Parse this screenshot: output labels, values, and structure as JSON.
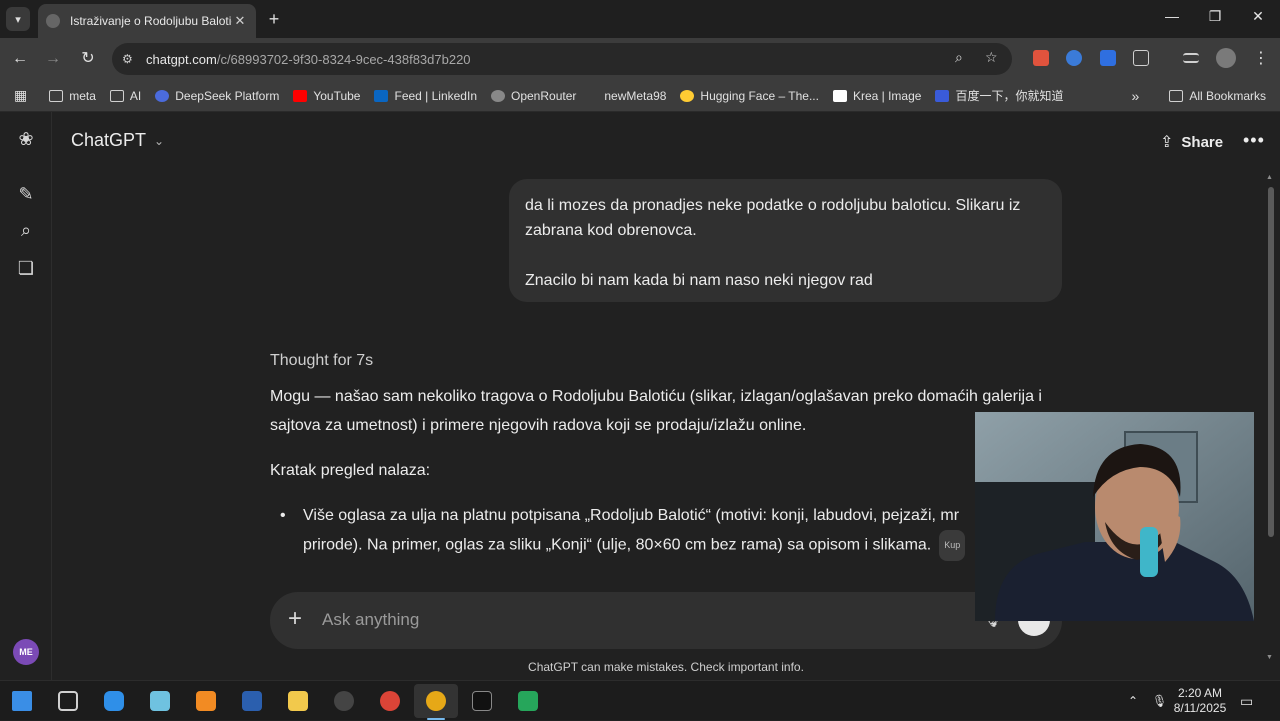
{
  "browser": {
    "tab": {
      "title": "Istraživanje o Rodoljubu Balotić"
    },
    "address": {
      "domain": "chatgpt.com",
      "path": "/c/68993702-9f30-8324-9cec-438f83d7b220"
    },
    "bookmarks": [
      {
        "label": "meta",
        "icon": "folder-icon"
      },
      {
        "label": "AI",
        "icon": "folder-icon"
      },
      {
        "label": "DeepSeek Platform",
        "icon": "deepseek-icon"
      },
      {
        "label": "YouTube",
        "icon": "youtube-icon"
      },
      {
        "label": "Feed | LinkedIn",
        "icon": "linkedin-icon"
      },
      {
        "label": "OpenRouter",
        "icon": "openrouter-icon"
      },
      {
        "label": "newMeta98",
        "icon": ""
      },
      {
        "label": "Hugging Face – The...",
        "icon": "huggingface-icon"
      },
      {
        "label": "Krea | Image",
        "icon": "krea-icon"
      },
      {
        "label": "百度一下，你就知道",
        "icon": "baidu-icon"
      }
    ],
    "all_bookmarks": "All Bookmarks"
  },
  "chatgpt": {
    "model": "ChatGPT",
    "share": "Share",
    "user_message": {
      "line1": "da li mozes da pronadjes neke podatke o rodoljubu baloticu. Slikaru iz zabrana kod obrenovca.",
      "line2": "Znacilo bi nam kada bi nam naso neki njegov rad"
    },
    "thought": "Thought for 7s",
    "assistant": {
      "intro": "Mogu — našao sam nekoliko tragova o Rodoljubu Balotiću (slikar, izlagan/oglašavan preko domaćih galerija i sajtova za umetnost) i primere njegovih radova koji se prodaju/izlažu online.",
      "summary_heading": "Kratak pregled nalaza:",
      "bullet1": "Više oglasa za ulja na platnu potpisana „Rodoljub Balotić“ (motivi: konji, labudovi, pejzaži, mr prirode). Na primer, oglas za sliku „Konji“ (ulje, 80×60 cm bez rama) sa opisom i slikama.",
      "bullet1_cite": "Kup"
    },
    "composer": {
      "placeholder": "Ask anything"
    },
    "disclaimer": "ChatGPT can make mistakes. Check important info.",
    "avatar_initials": "ME"
  },
  "taskbar": {
    "time": "2:20 AM",
    "date": "8/11/2025"
  },
  "colors": {
    "background": "#212121",
    "bubble": "#303030",
    "browser_chrome": "#3c3c3c",
    "avatar": "#7b4ab6"
  }
}
